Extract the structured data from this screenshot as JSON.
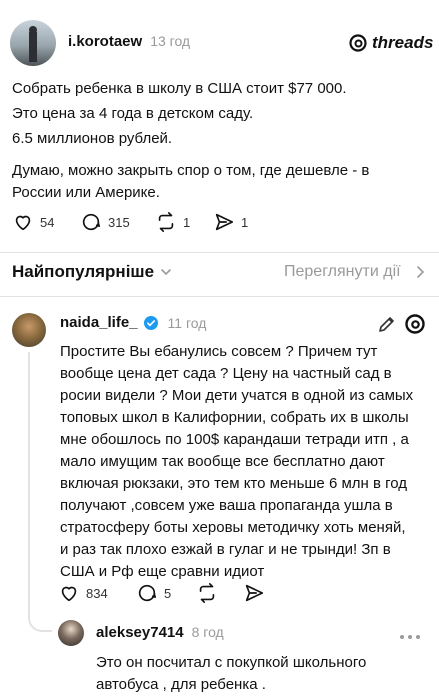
{
  "post": {
    "username": "i.korotaew",
    "time": "13 год",
    "brand": "threads",
    "paragraph1": [
      "Собрать ребенка в школу в США стоит $77 000.",
      "Это цена за 4 года в детском саду.",
      "6.5 миллионов рублей."
    ],
    "paragraph2": [
      "Думаю, можно закрыть спор о том, где дешевле - в",
      "России или Америке."
    ],
    "likes": "54",
    "comments": "315",
    "reposts": "1",
    "shares": "1"
  },
  "sort": {
    "label": "Найпопулярніше",
    "view_activity": "Переглянути дії"
  },
  "reply1": {
    "username": "naida_life_",
    "time": "11 год",
    "lines": [
      "Простите Вы ебанулись совсем ? Причем тут",
      "вообще цена дет сада ? Цену на частный сад в",
      "росии видели ? Мои дети учатся в одной из самых",
      "топовых школ в Калифорнии, собрать их в школы",
      "мне обошлось по 100$ карандаши тетради итп , а",
      "мало имущим так вообще все бесплатно дают",
      "включая рюкзаки, это тем кто меньше 6 млн в год",
      "получают ,совсем уже ваша пропаганда ушла в",
      "стратосферу боты херовы методичку хоть меняй,",
      "и раз так плохо езжай в гулаг и не трынди! Зп в",
      "США и Рф еще сравни идиот"
    ],
    "likes": "834",
    "comments": "5"
  },
  "reply2": {
    "username": "aleksey7414",
    "time": "8 год",
    "lines": [
      "Это он посчитал с покупкой школьного",
      "автобуса , для ребенка ."
    ]
  }
}
